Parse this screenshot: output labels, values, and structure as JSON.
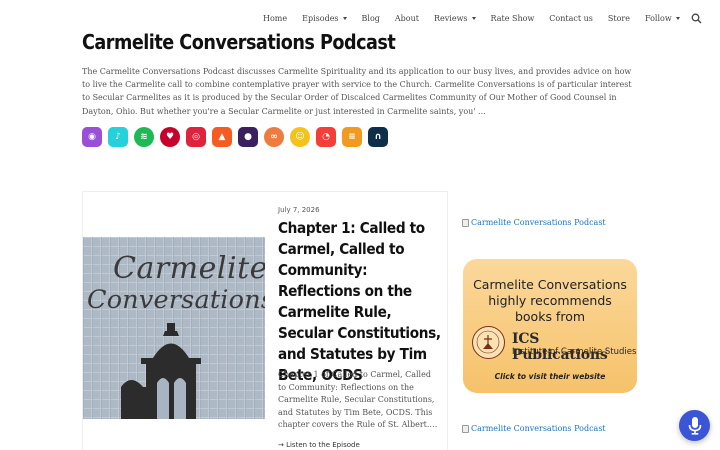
{
  "nav": {
    "items": [
      {
        "label": "Home",
        "dropdown": false
      },
      {
        "label": "Episodes",
        "dropdown": true
      },
      {
        "label": "Blog",
        "dropdown": false
      },
      {
        "label": "About",
        "dropdown": false
      },
      {
        "label": "Reviews",
        "dropdown": true
      },
      {
        "label": "Rate Show",
        "dropdown": false
      },
      {
        "label": "Contact us",
        "dropdown": false
      },
      {
        "label": "Store",
        "dropdown": false
      },
      {
        "label": "Follow",
        "dropdown": true
      }
    ],
    "search_icon": "search-icon"
  },
  "podcast": {
    "title": "Carmelite Conversations Podcast",
    "description": "The Carmelite Conversations Podcast discusses Carmelite Spirituality and its application to our busy lives, and provides advice on how to live the Carmelite call to combine contemplative prayer with service to the Church. Carmelite Conversations is of particular interest to Secular Carmelites as it is produced by the Secular Order of Discalced Carmelites Community of Our Mother of Good Counsel in Dayton, Ohio. But whether you're a Secular Carmelite or just interested in Carmelite saints, you' ..."
  },
  "platforms": [
    {
      "icon": "apple-podcasts-icon",
      "color": "#9b4fd6",
      "glyph": "◉"
    },
    {
      "icon": "amazon-music-icon",
      "color": "#25d1da",
      "glyph": "♪"
    },
    {
      "icon": "spotify-icon",
      "color": "#1db954",
      "glyph": "≋"
    },
    {
      "icon": "iheartradio-icon",
      "color": "#c6002b",
      "glyph": "♥"
    },
    {
      "icon": "podcast-addict-icon",
      "color": "#e0233d",
      "glyph": "◎"
    },
    {
      "icon": "castbox-icon",
      "color": "#f55b23",
      "glyph": "▲"
    },
    {
      "icon": "podchaser-icon",
      "color": "#3c1f5e",
      "glyph": "●"
    },
    {
      "icon": "player-fm-icon",
      "color": "#f07b3f",
      "glyph": "∞"
    },
    {
      "icon": "podcast-republic-icon",
      "color": "#f3c21b",
      "glyph": "☺"
    },
    {
      "icon": "pocket-casts-icon",
      "color": "#f43e37",
      "glyph": "◔"
    },
    {
      "icon": "rss-icon",
      "color": "#f39a1e",
      "glyph": "≡"
    },
    {
      "icon": "podcast-app-icon",
      "color": "#0f2e4a",
      "glyph": "∩"
    }
  ],
  "episode": {
    "date": "July 7, 2026",
    "title": "Chapter 1: Called to Carmel, Called to Community: Reflections on the Carmelite Rule, Secular Constitutions, and Statutes by Tim Bete, OCDS",
    "excerpt": "Chapter 1 of Called to Carmel, Called to Community: Reflections on the Carmelite Rule, Secular Constitutions, and Statutes by Tim Bete, OCDS. This chapter covers the Rule of St. Albert.…",
    "listen_label": "→ Listen to the Episode",
    "artwork_text": [
      "Carmelite",
      "Conversations"
    ]
  },
  "sidebar": {
    "link1": "Carmelite Conversations Podcast",
    "link2": "Carmelite Conversations Podcast",
    "ad": {
      "line1": "Carmelite Conversations",
      "line2": "highly recommends",
      "line3": "books from",
      "brand": "ICS Publications",
      "institute": "Institute of Carmelite Studies",
      "cta": "Click to visit their website"
    }
  },
  "colors": {
    "accent": "#3a55d6",
    "link": "#1a73c8"
  }
}
